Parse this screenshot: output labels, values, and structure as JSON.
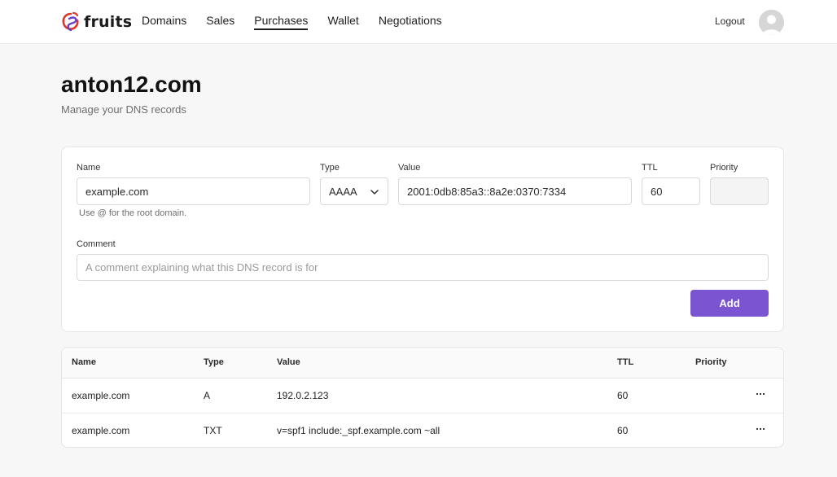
{
  "header": {
    "brand": "fruits",
    "nav": [
      {
        "label": "Domains"
      },
      {
        "label": "Sales"
      },
      {
        "label": "Purchases"
      },
      {
        "label": "Wallet"
      },
      {
        "label": "Negotiations"
      }
    ],
    "active_nav": "Purchases",
    "logout_label": "Logout"
  },
  "page": {
    "title": "anton12.com",
    "subtitle": "Manage your DNS records"
  },
  "form": {
    "name_label": "Name",
    "name_value": "example.com",
    "name_hint": "Use @ for the root domain.",
    "type_label": "Type",
    "type_value": "AAAA",
    "value_label": "Value",
    "value_value": "2001:0db8:85a3::8a2e:0370:7334",
    "ttl_label": "TTL",
    "ttl_value": "60",
    "priority_label": "Priority",
    "priority_value": "",
    "comment_label": "Comment",
    "comment_placeholder": "A comment explaining what this DNS record is for",
    "add_label": "Add"
  },
  "table": {
    "columns": [
      "Name",
      "Type",
      "Value",
      "TTL",
      "Priority"
    ],
    "rows": [
      {
        "name": "example.com",
        "type": "A",
        "value": "192.0.2.123",
        "ttl": "60",
        "priority": ""
      },
      {
        "name": "example.com",
        "type": "TXT",
        "value": "v=spf1 include:_spf.example.com ~all",
        "ttl": "60",
        "priority": ""
      }
    ]
  },
  "colors": {
    "accent": "#7a54d1",
    "logo_red": "#e0362c",
    "logo_purple": "#6a3fc7"
  },
  "icons": {
    "logo": "fruits-logo-icon",
    "select": "chevron-down-icon",
    "row_actions": "more-horizontal-icon",
    "avatar": "user-avatar-icon"
  }
}
